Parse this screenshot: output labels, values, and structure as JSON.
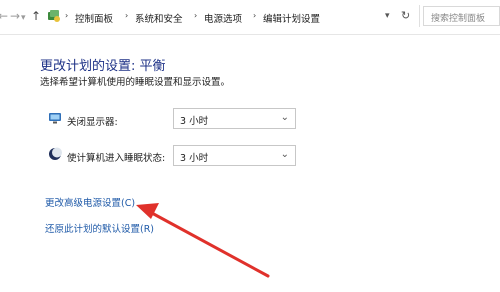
{
  "address_bar": {
    "back_glyph": "←",
    "forward_glyph": "→",
    "dropdown_glyph": "▾",
    "up_glyph": "↑",
    "breadcrumbs": [
      "控制面板",
      "系统和安全",
      "电源选项",
      "编辑计划设置"
    ],
    "refresh_glyph": "↻",
    "search_placeholder": "搜索控制面板"
  },
  "main": {
    "title": "更改计划的设置: 平衡",
    "subtitle": "选择希望计算机使用的睡眠设置和显示设置。",
    "settings": [
      {
        "icon": "monitor-icon",
        "label": "关闭显示器:",
        "value": "3 小时"
      },
      {
        "icon": "moon-sleep-icon",
        "label": "使计算机进入睡眠状态:",
        "value": "3 小时"
      }
    ],
    "advanced_link": "更改高级电源设置(C)",
    "restore_link": "还原此计划的默认设置(R)"
  },
  "annotation": {
    "arrow_color": "#e0312b"
  }
}
